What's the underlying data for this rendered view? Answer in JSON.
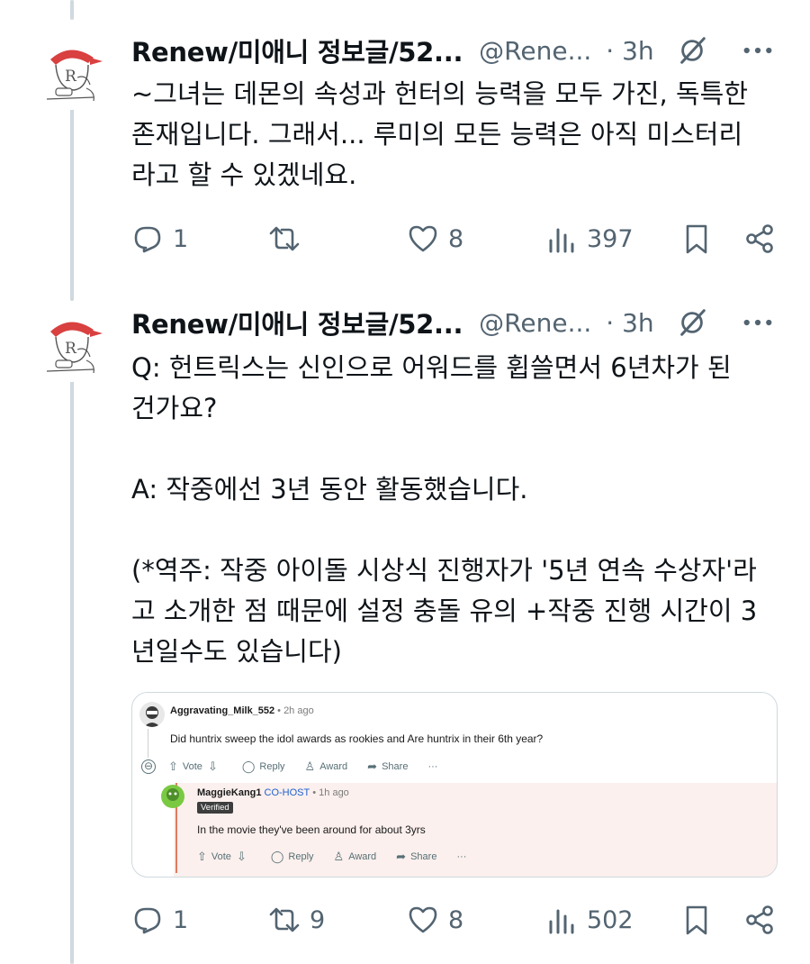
{
  "colors": {
    "text": "#0f1419",
    "muted": "#536471",
    "thread_line": "#cfd9de",
    "reddit_cohost": "#1e5fd0",
    "reddit_reply_bg": "#fbf0ed"
  },
  "icons": [
    "avatar",
    "grok-icon",
    "more-icon",
    "reply-icon",
    "retweet-icon",
    "like-icon",
    "views-icon",
    "bookmark-icon",
    "share-icon"
  ],
  "tweets": [
    {
      "name": "Renew/미애니 정보글/52...",
      "handle": "@Rene...",
      "time": "· 3h",
      "text": "~그녀는 데몬의 속성과 헌터의 능력을 모두 가진, 독특한\n존재입니다. 그래서... 루미의 모든 능력은 아직 미스터리\n라고 할 수 있겠네요.",
      "replies": "1",
      "reposts": "",
      "likes": "8",
      "views": "397"
    },
    {
      "name": "Renew/미애니 정보글/52...",
      "handle": "@Rene...",
      "time": "· 3h",
      "text": "Q: 헌트릭스는 신인으로 어워드를 휩쓸면서 6년차가 된\n건가요?\n\nA: 작중에선 3년 동안 활동했습니다.\n\n(*역주: 작중 아이돌 시상식 진행자가 '5년 연속 수상자'라\n고 소개한 점 때문에 설정 충돌 유의 +작중 진행 시간이 3\n년일수도 있습니다)",
      "replies": "1",
      "reposts": "9",
      "likes": "8",
      "views": "502"
    }
  ],
  "embed": {
    "comment": {
      "user": "Aggravating_Milk_552",
      "time": "• 2h ago",
      "text": "Did huntrix sweep the idol awards as rookies and Are huntrix in their 6th year?",
      "collapse": "⊖",
      "actions": {
        "vote": "Vote",
        "reply": "Reply",
        "award": "Award",
        "share": "Share",
        "more": "···"
      }
    },
    "reply": {
      "user": "MaggieKang1",
      "role": "CO-HOST",
      "time": "• 1h ago",
      "badge": "Verified",
      "text": "In the movie they've been around for about 3yrs",
      "actions": {
        "vote": "Vote",
        "reply": "Reply",
        "award": "Award",
        "share": "Share",
        "more": "···"
      }
    }
  }
}
